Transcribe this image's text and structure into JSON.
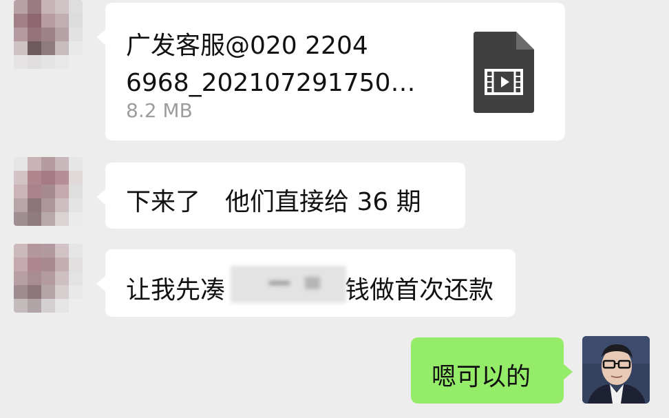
{
  "messages": [
    {
      "type": "file",
      "file_name": "广发客服@020 2204 6968_202107291750…",
      "file_size": "8.2 MB",
      "file_icon": "video-file-icon"
    },
    {
      "type": "text",
      "text": "下来了　他们直接给 36 期"
    },
    {
      "type": "text",
      "text_before": "让我先凑",
      "text_after": "钱做首次还款"
    },
    {
      "type": "text",
      "sender": "self",
      "text": "嗯可以的"
    }
  ],
  "colors": {
    "background": "#ededed",
    "incoming_bubble": "#ffffff",
    "outgoing_bubble": "#95ec69",
    "file_icon": "#404040"
  }
}
